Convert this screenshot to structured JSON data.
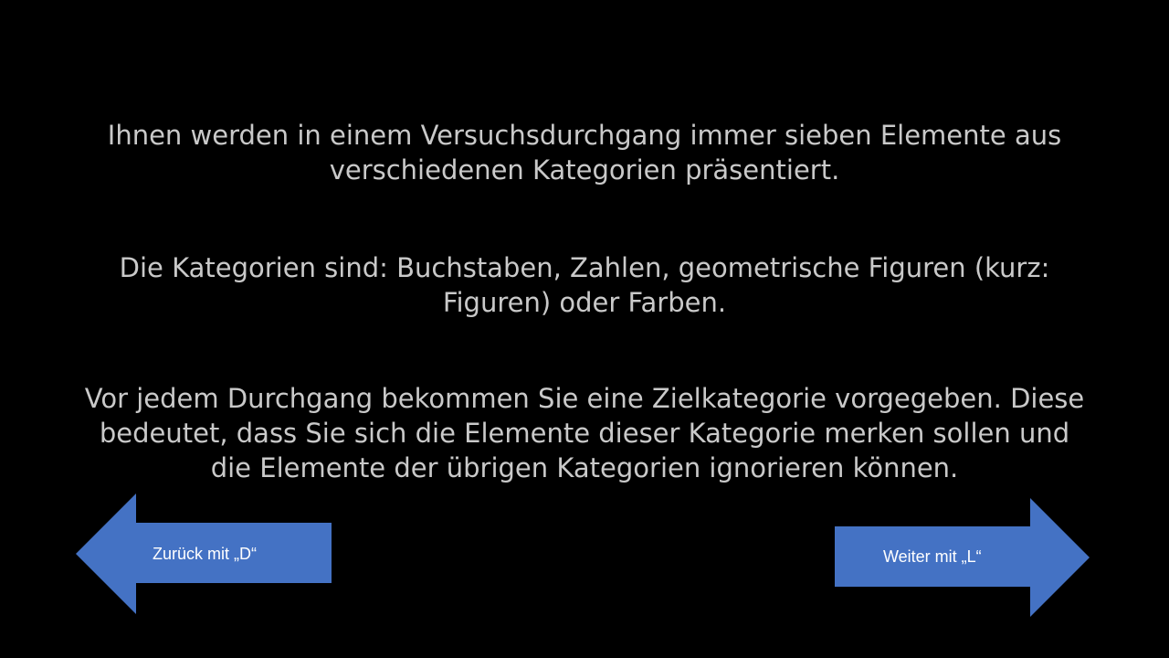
{
  "instructions": {
    "paragraph_1": {
      "line_1": "Ihnen werden in einem Versuchsdurchgang immer sieben Elemente aus",
      "line_2": "verschiedenen Kategorien präsentiert."
    },
    "paragraph_2": {
      "line_1": "Die Kategorien sind: Buchstaben, Zahlen, geometrische Figuren (kurz:",
      "line_2": "Figuren) oder Farben."
    },
    "paragraph_3": {
      "line_1": "Vor jedem Durchgang bekommen Sie eine Zielkategorie vorgegeben. Diese",
      "line_2": "bedeutet, dass Sie sich die Elemente dieser Kategorie merken sollen und",
      "line_3": "die Elemente der übrigen Kategorien ignorieren können."
    }
  },
  "navigation": {
    "back_label": "Zurück mit „D“",
    "next_label": "Weiter mit „L“",
    "back_icon": "left-arrow-icon",
    "next_icon": "right-arrow-icon"
  },
  "colors": {
    "background": "#000000",
    "text": "#c9c9c9",
    "arrow_fill": "#4472c4",
    "arrow_text": "#ffffff"
  }
}
